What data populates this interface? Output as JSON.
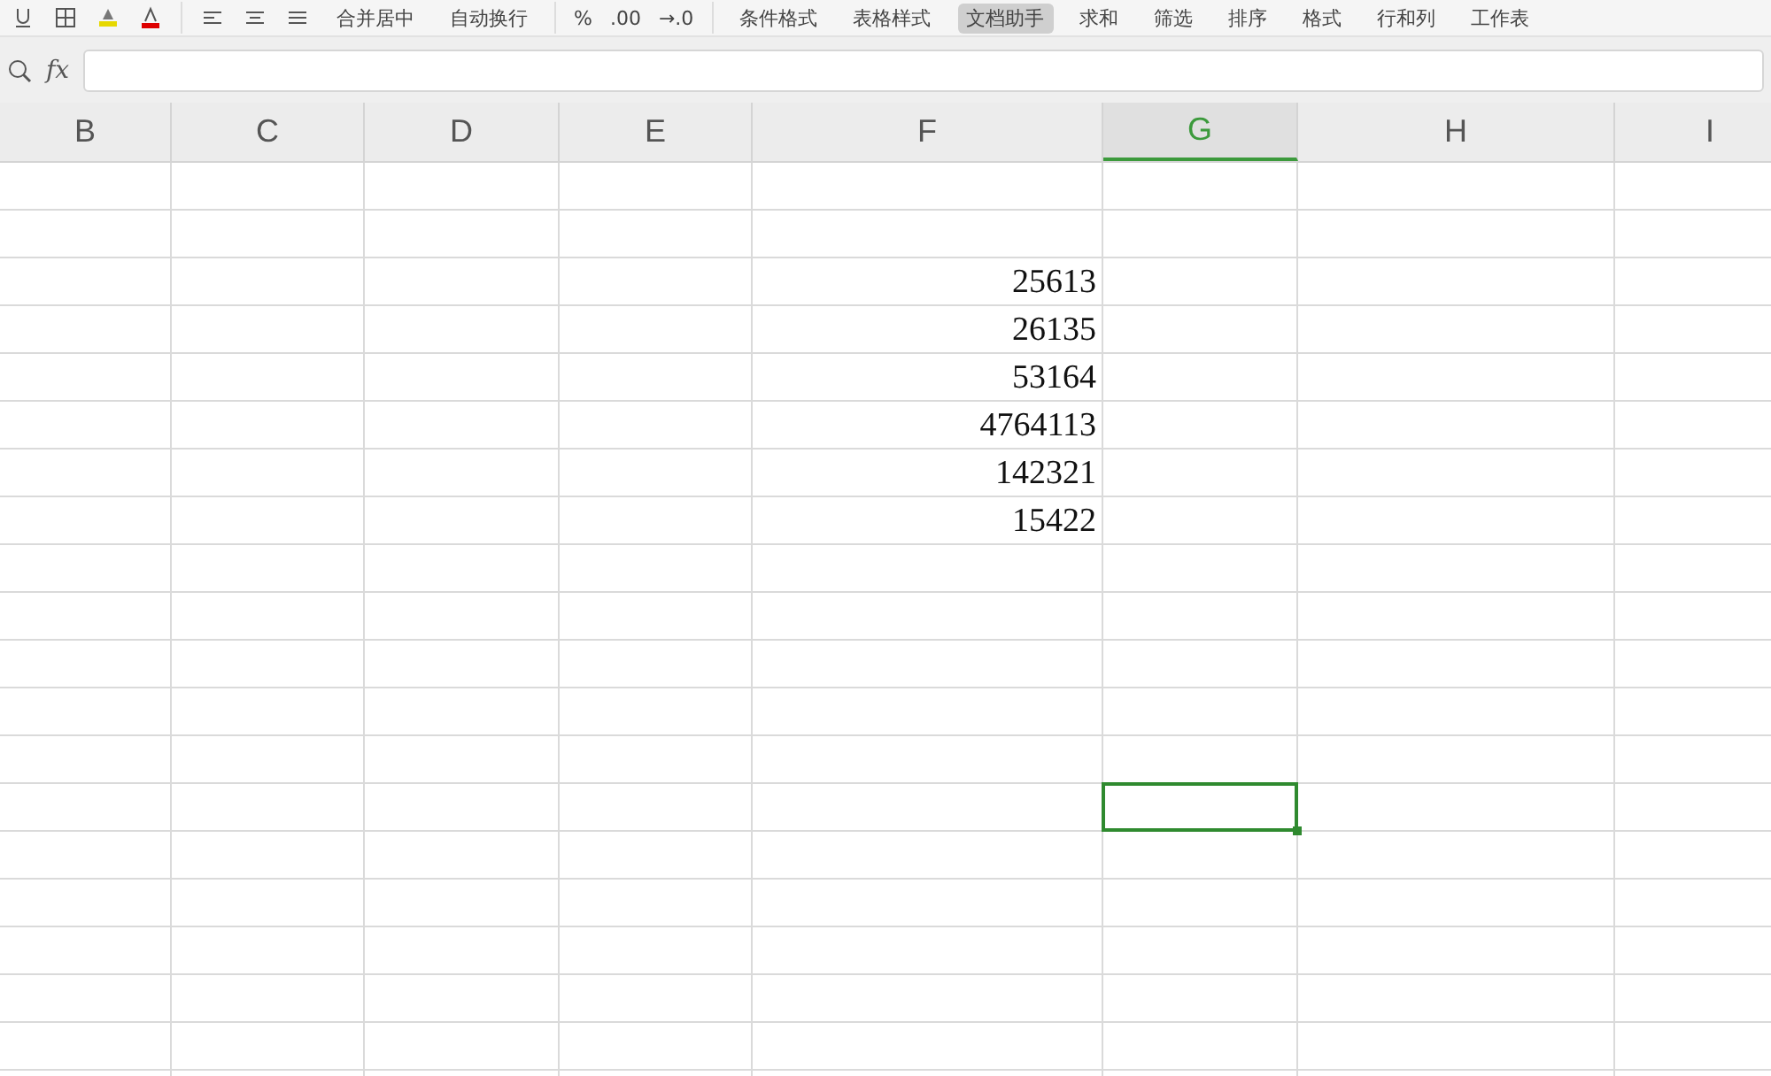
{
  "toolbar": {
    "merge_buttons": [
      {
        "label": "合并居中"
      },
      {
        "label": "自动换行"
      }
    ],
    "number_format": [
      {
        "label": "%"
      },
      {
        "label": ".00"
      },
      {
        "label": "→.0"
      }
    ],
    "buttons": [
      {
        "label": "条件格式",
        "selected": false
      },
      {
        "label": "表格样式",
        "selected": false
      },
      {
        "label": "文档助手",
        "selected": true
      },
      {
        "label": "求和",
        "selected": false
      },
      {
        "label": "筛选",
        "selected": false
      },
      {
        "label": "排序",
        "selected": false
      },
      {
        "label": "格式",
        "selected": false
      },
      {
        "label": "行和列",
        "selected": false
      },
      {
        "label": "工作表",
        "selected": false
      }
    ]
  },
  "formula_bar": {
    "fx_label": "fx"
  },
  "columns": [
    {
      "label": "B",
      "selected": false
    },
    {
      "label": "C",
      "selected": false
    },
    {
      "label": "D",
      "selected": false
    },
    {
      "label": "E",
      "selected": false
    },
    {
      "label": "F",
      "selected": false,
      "values": [
        "25613",
        "26135",
        "53164",
        "4764113",
        "142321",
        "15422"
      ]
    },
    {
      "label": "G",
      "selected": true
    },
    {
      "label": "H",
      "selected": false
    },
    {
      "label": "I",
      "selected": false
    }
  ]
}
